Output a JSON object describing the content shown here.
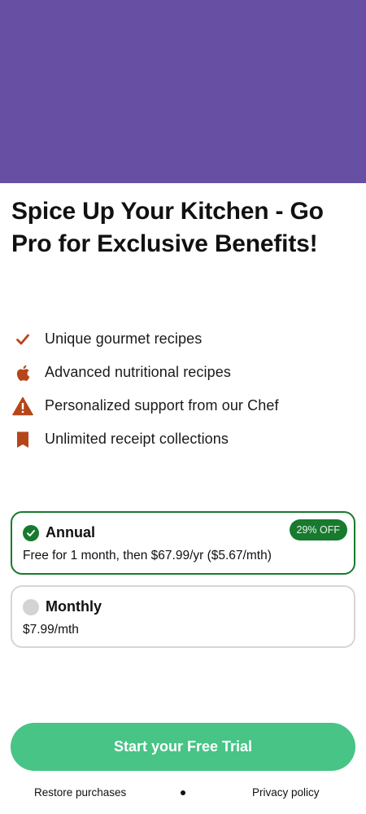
{
  "colors": {
    "hero_background": "#6750A4",
    "feature_icon": "#B5461A",
    "selected_green": "#177A2E",
    "unselected_gray": "#D3D3D3",
    "cta_background": "#47C486"
  },
  "title": "Spice Up Your Kitchen - Go Pro for Exclusive Benefits!",
  "features": [
    {
      "icon": "check-icon",
      "label": "Unique gourmet recipes"
    },
    {
      "icon": "apple-icon",
      "label": "Advanced nutritional recipes"
    },
    {
      "icon": "warning-icon",
      "label": "Personalized support from our Chef"
    },
    {
      "icon": "bookmark-icon",
      "label": "Unlimited receipt collections"
    }
  ],
  "plans": {
    "annual": {
      "name": "Annual",
      "description": "Free for 1 month, then $67.99/yr ($5.67/mth)",
      "badge": "29% OFF",
      "selected": true
    },
    "monthly": {
      "name": "Monthly",
      "description": "$7.99/mth",
      "selected": false
    }
  },
  "cta": {
    "label": "Start your Free Trial"
  },
  "footer": {
    "restore": "Restore purchases",
    "privacy": "Privacy policy"
  }
}
